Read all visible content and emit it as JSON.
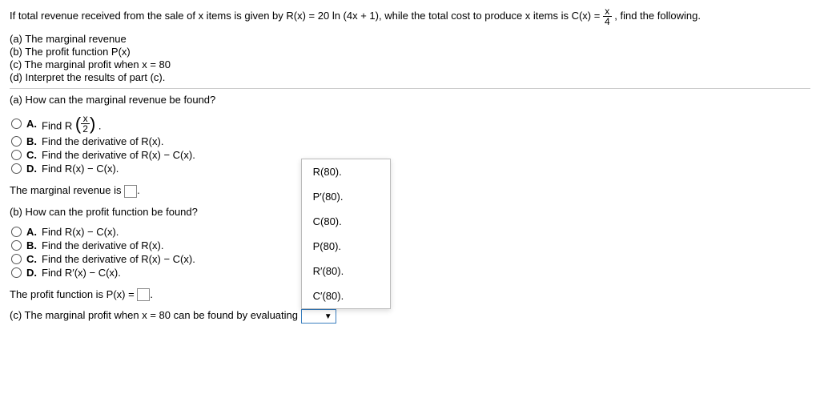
{
  "intro_pre": "If total revenue received from the sale of x items is given by R(x) = 20 ln (4x + 1), while the total cost to produce x items is C(x) = ",
  "intro_frac": {
    "num": "x",
    "den": "4"
  },
  "intro_post": ", find the following.",
  "parts": {
    "a": "(a) The marginal revenue",
    "b": "(b) The profit function P(x)",
    "c": "(c) The marginal profit when x = 80",
    "d": "(d) Interpret the results of part (c)."
  },
  "qa": {
    "prompt": "(a) How can the marginal revenue be found?",
    "A_pre": "Find R",
    "A_frac": {
      "num": "x",
      "den": "2"
    },
    "A_post": ".",
    "B": "Find the derivative of R(x).",
    "C": "Find the derivative of R(x) − C(x).",
    "D": "Find R(x) − C(x).",
    "answer": "The marginal revenue is "
  },
  "qb": {
    "prompt": "(b) How can the profit function be found?",
    "A": "Find R(x) − C(x).",
    "B": "Find the derivative of R(x).",
    "C": "Find the derivative of R(x) − C(x).",
    "D": "Find R′(x) − C(x).",
    "answer": "The profit function is P(x) = "
  },
  "qc": {
    "prompt": "(c) The marginal profit when x = 80 can be found by evaluating "
  },
  "labels": {
    "A": "A.",
    "B": "B.",
    "C": "C.",
    "D": "D."
  },
  "dropdown": {
    "items": [
      "R(80).",
      "P′(80).",
      "C(80).",
      "P(80).",
      "R′(80).",
      "C′(80)."
    ]
  },
  "period": "."
}
